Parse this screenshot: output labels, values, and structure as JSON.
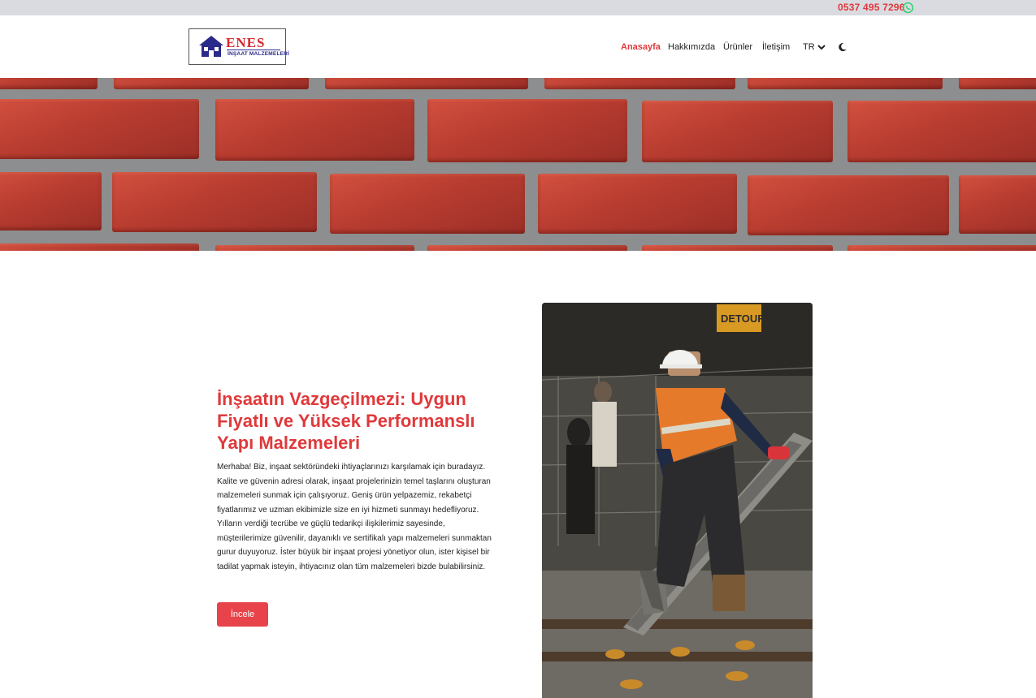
{
  "topbar": {
    "phone": "0537 495 7296",
    "whatsapp_icon": "whatsapp-icon"
  },
  "logo": {
    "brand": "ENES",
    "subtitle": "İNŞAAT MALZEMELERİ"
  },
  "nav": {
    "home": "Anasayfa",
    "about": "Hakkımızda",
    "products": "Ürünler",
    "contact": "İletişim",
    "language": "TR",
    "theme_icon": "moon-icon"
  },
  "content": {
    "title": "İnşaatın Vazgeçilmezi: Uygun Fiyatlı ve Yüksek Performanslı Yapı Malzemeleri",
    "text": "Merhaba! Biz, inşaat sektöründeki ihtiyaçlarınızı karşılamak için buradayız. Kalite ve güvenin adresi olarak, inşaat projelerinizin temel taşlarını oluşturan malzemeleri sunmak için çalışıyoruz. Geniş ürün yelpazemiz, rekabetçi fiyatlarımız ve uzman ekibimizle size en iyi hizmeti sunmayı hedefliyoruz. Yılların verdiği tecrübe ve güçlü tedarikçi ilişkilerimiz sayesinde, müşterilerimize güvenilir, dayanıklı ve sertifikalı yapı malzemeleri sunmaktan gurur duyuyoruz. İster büyük bir inşaat projesi yönetiyor olun, ister kişisel bir tadilat yapmak isteyin, ihtiyacınız olan tüm malzemeleri bizde bulabilirsiniz.",
    "button": "İncele"
  },
  "photo": {
    "sign": "DETOUR"
  },
  "colors": {
    "accent": "#e0393b",
    "topbar": "#d9dbe1",
    "whatsapp": "#25d366"
  }
}
